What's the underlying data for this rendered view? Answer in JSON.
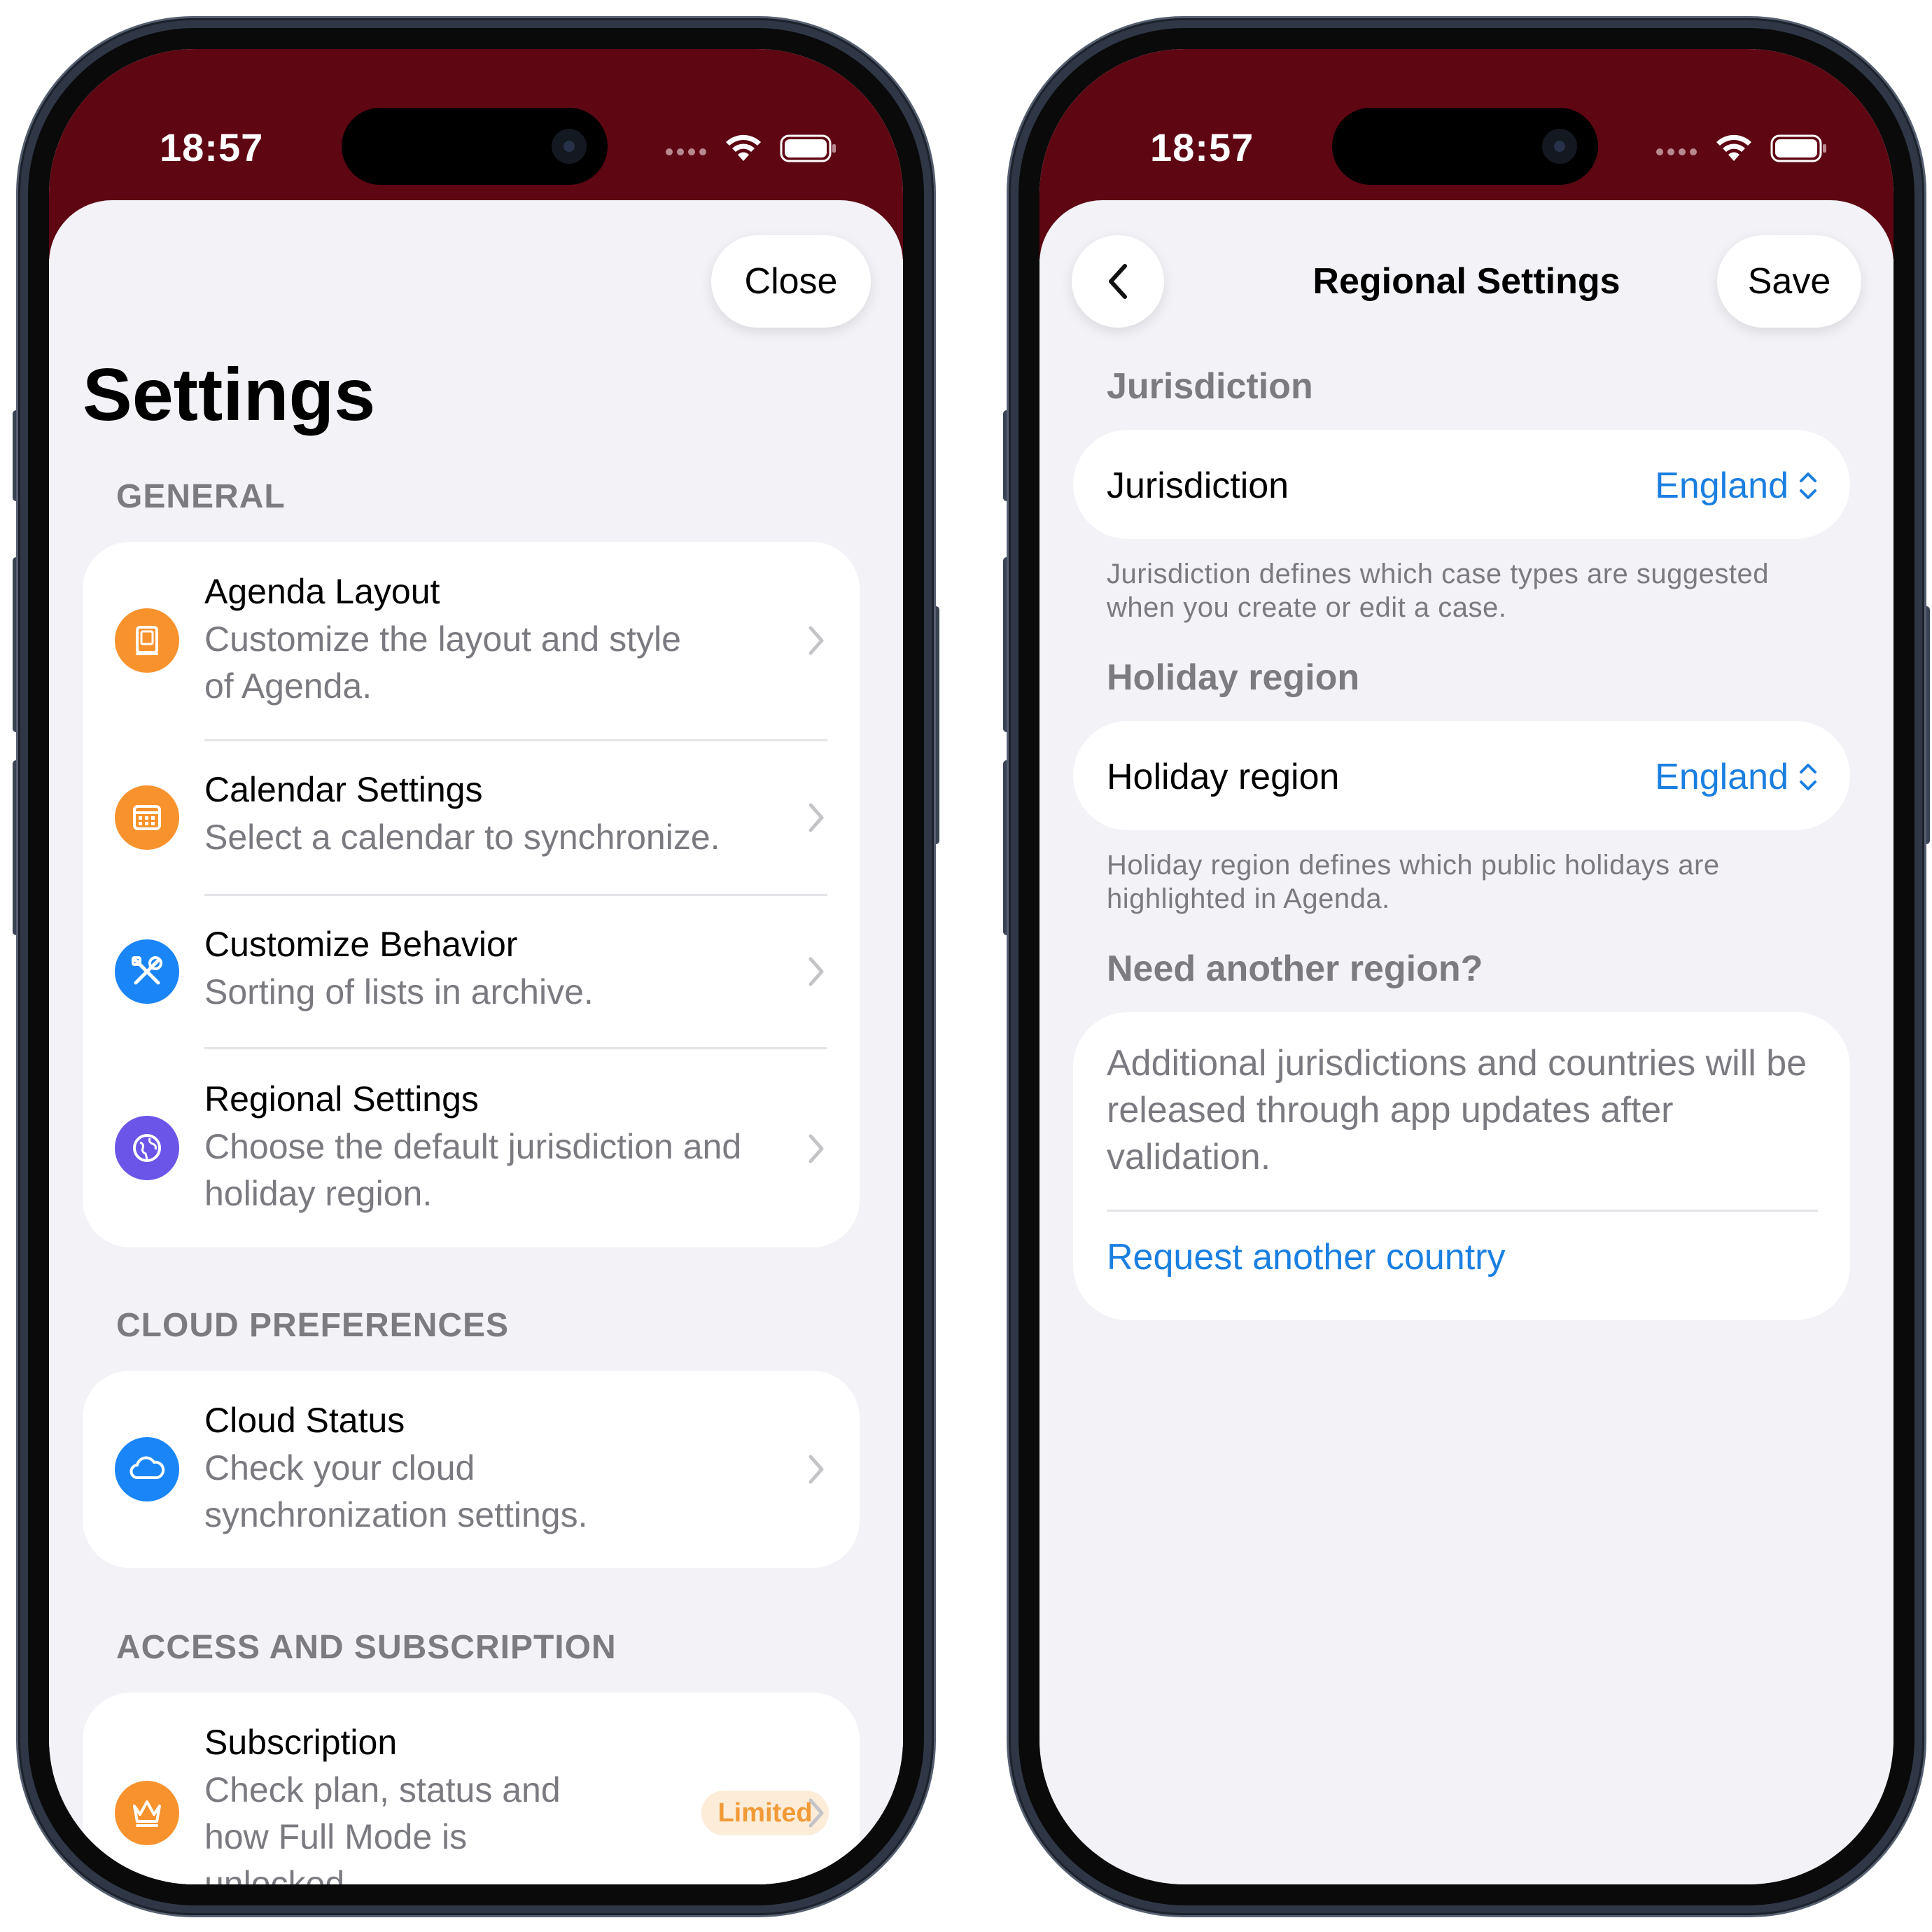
{
  "status_bar": {
    "time": "18:57"
  },
  "settings_screen": {
    "close_label": "Close",
    "title": "Settings",
    "sections": [
      {
        "header": "GENERAL"
      },
      {
        "header": "CLOUD PREFERENCES"
      },
      {
        "header": "ACCESS AND SUBSCRIPTION"
      }
    ],
    "items": {
      "agenda_layout": {
        "title": "Agenda Layout",
        "subtitle": "Customize the layout and style\nof Agenda.",
        "icon": "book-icon",
        "color": "#f7922d"
      },
      "calendar_settings": {
        "title": "Calendar Settings",
        "subtitle": "Select a calendar to synchronize.",
        "icon": "calendar-icon",
        "color": "#f7922d"
      },
      "customize_behavior": {
        "title": "Customize Behavior",
        "subtitle": "Sorting of lists in archive.",
        "icon": "tools-icon",
        "color": "#1a85f7"
      },
      "regional_settings": {
        "title": "Regional Settings",
        "subtitle": "Choose the default jurisdiction and\nholiday region.",
        "icon": "globe-icon",
        "color": "#6a55e8"
      },
      "cloud_status": {
        "title": "Cloud Status",
        "subtitle": "Check your cloud\nsynchronization settings.",
        "icon": "cloud-icon",
        "color": "#1a85f7"
      },
      "subscription": {
        "title": "Subscription",
        "subtitle": "Check plan, status and\nhow Full Mode is\nunlocked.",
        "icon": "crown-icon",
        "color": "#f7922d",
        "badge": "Limited"
      }
    }
  },
  "regional_screen": {
    "title": "Regional Settings",
    "save_label": "Save",
    "jurisdiction": {
      "header": "Jurisdiction",
      "label": "Jurisdiction",
      "value": "England",
      "footnote": "Jurisdiction defines which case types are suggested\nwhen you create or edit a case."
    },
    "holiday_region": {
      "header": "Holiday region",
      "label": "Holiday region",
      "value": "England",
      "footnote": "Holiday region defines which public holidays are\nhighlighted in Agenda."
    },
    "another_region": {
      "header": "Need another region?",
      "text": "Additional jurisdictions and countries will be\nreleased through app updates after\nvalidation.",
      "link": "Request another country"
    }
  },
  "colors": {
    "status_bar_bg": "#5e0713",
    "accent_blue": "#1a7fe0",
    "badge_orange": "#f19a37"
  }
}
